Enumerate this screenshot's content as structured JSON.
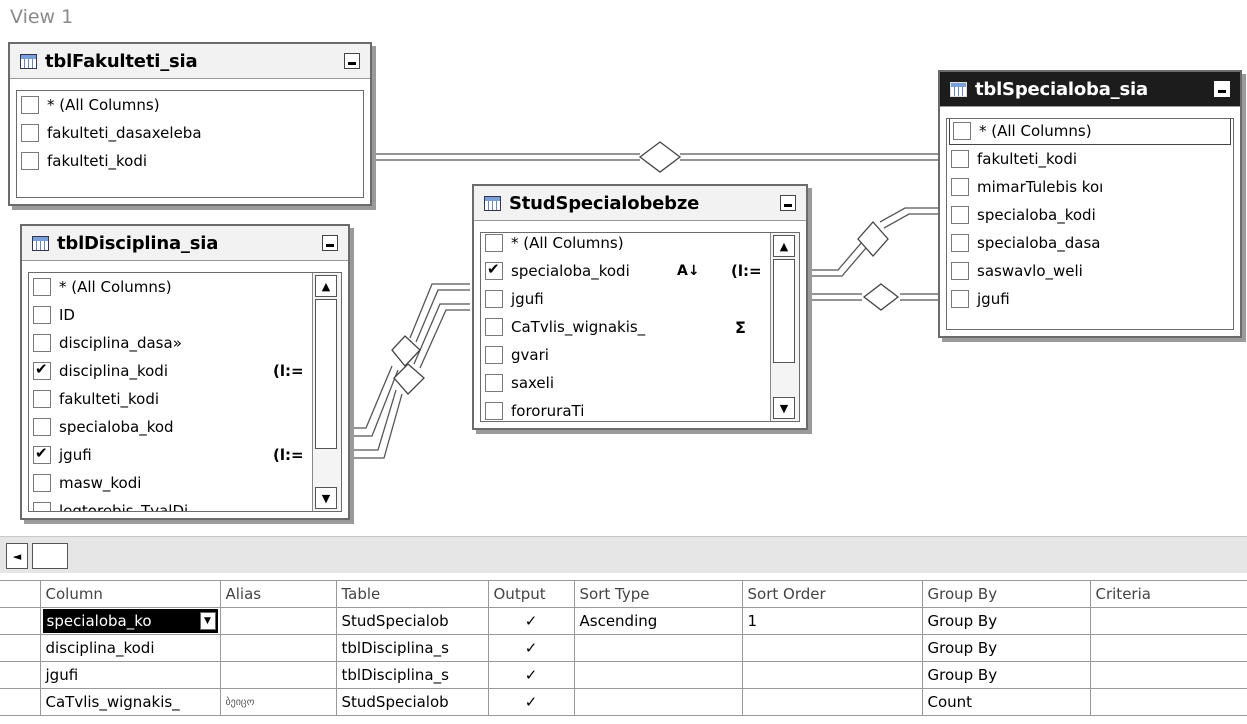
{
  "view_title": "View 1",
  "tables": {
    "fakulteti": {
      "title": "tblFakulteti_sia",
      "columns": [
        {
          "label": "* (All Columns)",
          "checked": false
        },
        {
          "label": "fakulteti_dasaxeleba",
          "checked": false
        },
        {
          "label": "fakulteti_kodi",
          "checked": false
        }
      ]
    },
    "disciplina": {
      "title": "tblDisciplina_sia",
      "columns": [
        {
          "label": "* (All Columns)",
          "checked": false
        },
        {
          "label": "ID",
          "checked": false
        },
        {
          "label": "disciplina_dasa»",
          "checked": false
        },
        {
          "label": "disciplina_kodi",
          "checked": true
        },
        {
          "label": "fakulteti_kodi",
          "checked": false
        },
        {
          "label": "specialoba_kod",
          "checked": false
        },
        {
          "label": "jgufi",
          "checked": true
        },
        {
          "label": "masw_kodi",
          "checked": false
        },
        {
          "label": "leqtorebis_TvalDi",
          "checked": false
        }
      ]
    },
    "stud": {
      "title": "StudSpecialobebze",
      "columns": [
        {
          "label": "* (All Columns)",
          "checked": false
        },
        {
          "label": "specialoba_kodi",
          "checked": true
        },
        {
          "label": "jgufi",
          "checked": false
        },
        {
          "label": "CaTvlis_wignakis_",
          "checked": false
        },
        {
          "label": "gvari",
          "checked": false
        },
        {
          "label": "saxeli",
          "checked": false
        },
        {
          "label": "fororuraTi",
          "checked": false
        }
      ]
    },
    "specialoba": {
      "title": "tblSpecialoba_sia",
      "columns": [
        {
          "label": "* (All Columns)",
          "checked": false
        },
        {
          "label": "fakulteti_kodi",
          "checked": false
        },
        {
          "label": "mimarTulebis koı",
          "checked": false
        },
        {
          "label": "specialoba_kodi",
          "checked": false
        },
        {
          "label": "specialoba_dasa",
          "checked": false
        },
        {
          "label": "saswavlo_weli",
          "checked": false
        },
        {
          "label": "jgufi",
          "checked": false
        }
      ]
    }
  },
  "grid": {
    "headers": [
      "Column",
      "Alias",
      "Table",
      "Output",
      "Sort Type",
      "Sort Order",
      "Group By",
      "Criteria"
    ],
    "rows": [
      {
        "column": "specialoba_ko",
        "alias": "",
        "table": "StudSpecialob",
        "output": "✓",
        "sort_type": "Ascending",
        "sort_order": "1",
        "group_by": "Group By",
        "criteria": ""
      },
      {
        "column": "disciplina_kodi",
        "alias": "",
        "table": "tblDisciplina_s",
        "output": "✓",
        "sort_type": "",
        "sort_order": "",
        "group_by": "Group By",
        "criteria": ""
      },
      {
        "column": "jgufi",
        "alias": "",
        "table": "tblDisciplina_s",
        "output": "✓",
        "sort_type": "",
        "sort_order": "",
        "group_by": "Group By",
        "criteria": ""
      },
      {
        "column": "CaTvlis_wignakis_",
        "alias": "ბეიცო",
        "table": "StudSpecialob",
        "output": "✓",
        "sort_type": "",
        "sort_order": "",
        "group_by": "Count",
        "criteria": ""
      }
    ]
  },
  "icons": {
    "key": "(l:=",
    "sort": "A↓",
    "sum": "Σ",
    "scroll_up": "▲",
    "scroll_down": "▼",
    "scroll_left": "◄",
    "dropdown": "▼"
  }
}
